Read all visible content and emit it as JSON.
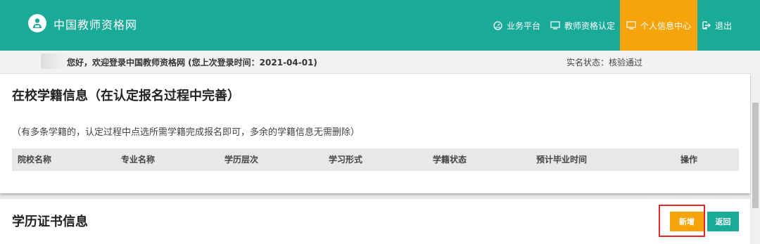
{
  "header": {
    "site_title": "中国教师资格网",
    "nav": [
      {
        "label": "业务平台",
        "icon": "speedometer-icon"
      },
      {
        "label": "教师资格认定",
        "icon": "monitor-icon"
      },
      {
        "label": "个人信息中心",
        "icon": "monitor-icon",
        "active": true
      },
      {
        "label": "退出",
        "icon": "logout-icon"
      }
    ]
  },
  "info_bar": {
    "greeting": "您好，欢迎登录中国教师资格网 (您上次登录时间：2021-04-01)",
    "realname_status": "实名状态：核验通过"
  },
  "school_section": {
    "title": "在校学籍信息（在认定报名过程中完善）",
    "note": "（有多条学籍的，认定过程中点选所需学籍完成报名即可，多余的学籍信息无需删除）",
    "columns": [
      "院校名称",
      "专业名称",
      "学历层次",
      "学习形式",
      "学籍状态",
      "预计毕业时间",
      "操作"
    ]
  },
  "cert_section": {
    "title": "学历证书信息",
    "new_button": "新增",
    "back_button": "返回"
  },
  "colors": {
    "primary": "#1aaa98",
    "accent": "#f5a40c",
    "highlight_border": "#e8262a"
  }
}
